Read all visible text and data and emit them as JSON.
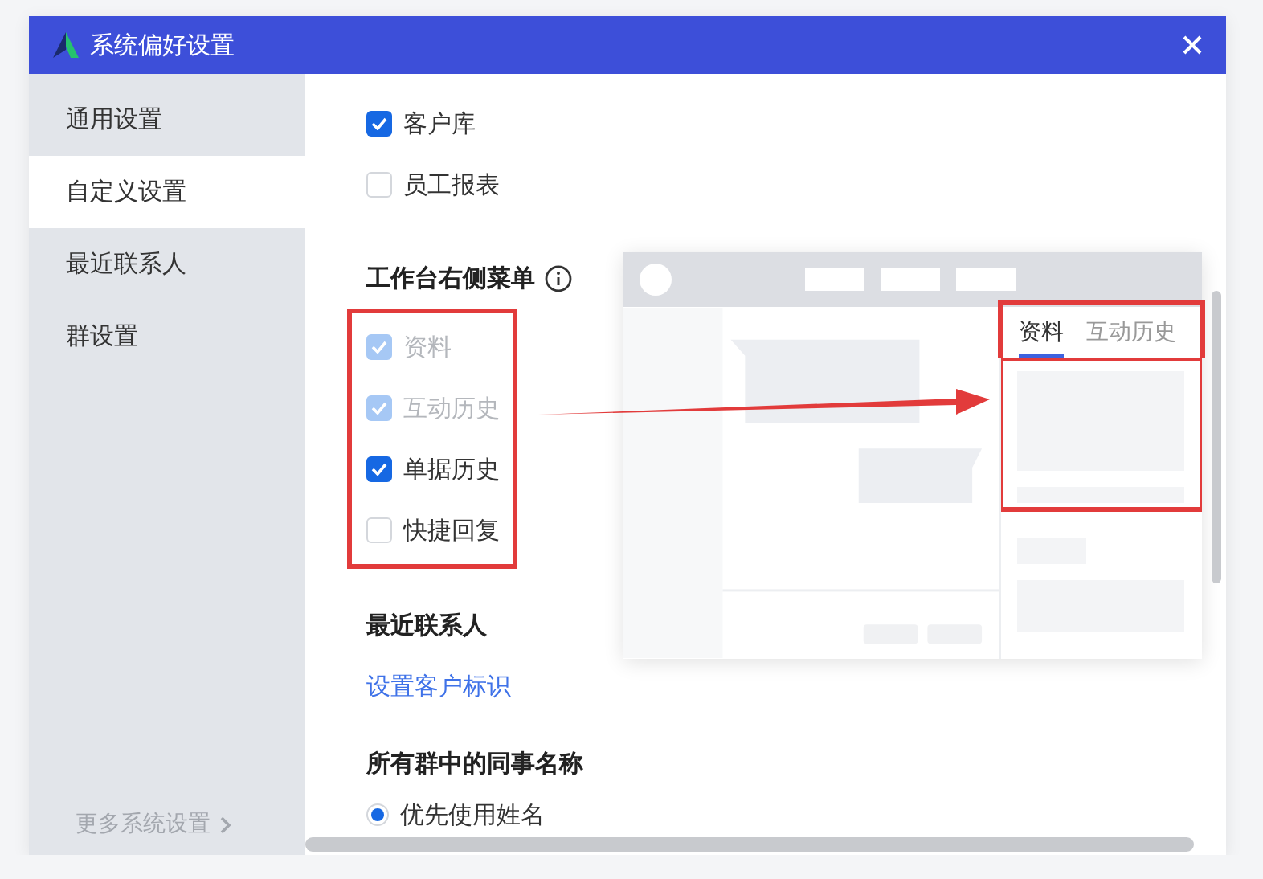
{
  "window": {
    "title": "系统偏好设置"
  },
  "sidebar": {
    "items": [
      {
        "label": "通用设置",
        "selected": false
      },
      {
        "label": "自定义设置",
        "selected": true
      },
      {
        "label": "最近联系人",
        "selected": false
      },
      {
        "label": "群设置",
        "selected": false
      }
    ],
    "footer": "更多系统设置"
  },
  "options": [
    {
      "label": "客户库",
      "checked": true,
      "disabled": false
    },
    {
      "label": "员工报表",
      "checked": false,
      "disabled": false
    }
  ],
  "workbench_menu": {
    "title": "工作台右侧菜单",
    "items": [
      {
        "label": "资料",
        "checked": true,
        "disabled": true
      },
      {
        "label": "互动历史",
        "checked": true,
        "disabled": true
      },
      {
        "label": "单据历史",
        "checked": true,
        "disabled": false
      },
      {
        "label": "快捷回复",
        "checked": false,
        "disabled": false
      }
    ],
    "preview": {
      "tabs": [
        {
          "label": "资料",
          "selected": true
        },
        {
          "label": "互动历史",
          "selected": false
        }
      ]
    }
  },
  "recent_contacts": {
    "title": "最近联系人",
    "link": "设置客户标识"
  },
  "colleague_names": {
    "title": "所有群中的同事名称",
    "options": [
      {
        "label": "优先使用姓名",
        "selected": true
      }
    ]
  }
}
